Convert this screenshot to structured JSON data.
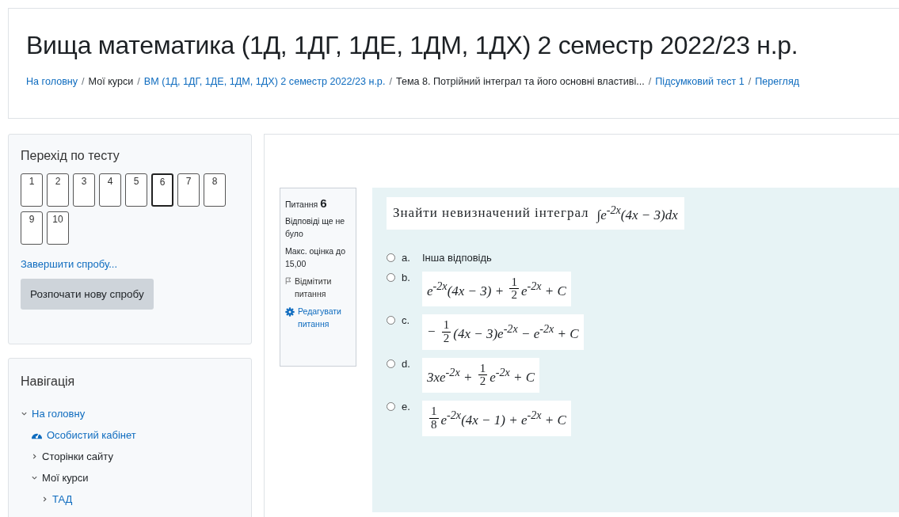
{
  "header": {
    "title": "Вища математика (1Д, 1ДГ, 1ДЕ, 1ДМ, 1ДХ) 2 семестр 2022/23 н.р.",
    "breadcrumb_separator": "/",
    "breadcrumb": [
      {
        "label": "На головну",
        "link": true
      },
      {
        "label": "Мої курси",
        "link": false
      },
      {
        "label": "ВМ (1Д, 1ДГ, 1ДЕ, 1ДМ, 1ДХ) 2 семестр 2022/23 н.р.",
        "link": true
      },
      {
        "label": "Тема 8. Потрійний інтеграл та його основні властиві...",
        "link": false
      },
      {
        "label": "Підсумковий тест 1",
        "link": true
      },
      {
        "label": "Перегляд",
        "link": true
      }
    ]
  },
  "quiz_navigation": {
    "title": "Перехід по тесту",
    "questions": [
      {
        "label": "1",
        "selected": false
      },
      {
        "label": "2",
        "selected": false
      },
      {
        "label": "3",
        "selected": false
      },
      {
        "label": "4",
        "selected": false
      },
      {
        "label": "5",
        "selected": false
      },
      {
        "label": "6",
        "selected": true
      },
      {
        "label": "7",
        "selected": false
      },
      {
        "label": "8",
        "selected": false
      },
      {
        "label": "9",
        "selected": false
      },
      {
        "label": "10",
        "selected": false
      }
    ],
    "finish_link": "Завершити спробу...",
    "restart_button": "Розпочати нову спробу"
  },
  "navigation": {
    "title": "Навігація",
    "items": [
      {
        "label": "На головну",
        "kind": "link",
        "expanded": true,
        "children": [
          {
            "label": "Особистий кабінет",
            "kind": "dashboard"
          },
          {
            "label": "Сторінки сайту",
            "kind": "plain",
            "expanded": false
          },
          {
            "label": "Мої курси",
            "kind": "plain",
            "expanded": true,
            "children": [
              {
                "label": "ТАД",
                "kind": "link",
                "expanded": false
              }
            ]
          }
        ]
      }
    ]
  },
  "question_info": {
    "label": "Питання",
    "number": "6",
    "state": "Відповіді ще не було",
    "mark": "Макс. оцінка до 15,00",
    "flag": "Відмітити питання",
    "edit": "Редагувати питання"
  },
  "question": {
    "prompt": "Знайти невизначений інтеграл",
    "integral": "∫e$^{-2x}$(4x − 3)dx",
    "options": [
      {
        "letter": "a.",
        "selected": false,
        "kind": "text",
        "text": "Інша відповідь"
      },
      {
        "letter": "b.",
        "selected": false,
        "kind": "formula",
        "parts": [
          {
            "kind": "text",
            "text": "e$^{-2x}$(4x − 3) + "
          },
          {
            "kind": "frac",
            "num": "1",
            "den": "2"
          },
          {
            "kind": "text",
            "text": "e$^{-2x}$ + C"
          }
        ]
      },
      {
        "letter": "c.",
        "selected": false,
        "kind": "formula",
        "parts": [
          {
            "kind": "text",
            "text": "− "
          },
          {
            "kind": "frac",
            "num": "1",
            "den": "2"
          },
          {
            "kind": "text",
            "text": "(4x − 3)e$^{-2x}$ − e$^{-2x}$ + C"
          }
        ]
      },
      {
        "letter": "d.",
        "selected": false,
        "kind": "formula",
        "parts": [
          {
            "kind": "text",
            "text": "3xe$^{-2x}$ + "
          },
          {
            "kind": "frac",
            "num": "1",
            "den": "2"
          },
          {
            "kind": "text",
            "text": "e$^{-2x}$ + C"
          }
        ]
      },
      {
        "letter": "e.",
        "selected": false,
        "kind": "formula",
        "parts": [
          {
            "kind": "frac",
            "num": "1",
            "den": "8"
          },
          {
            "kind": "text",
            "text": "e$^{-2x}$(4x − 1) + e$^{-2x}$ + C"
          }
        ]
      }
    ]
  }
}
